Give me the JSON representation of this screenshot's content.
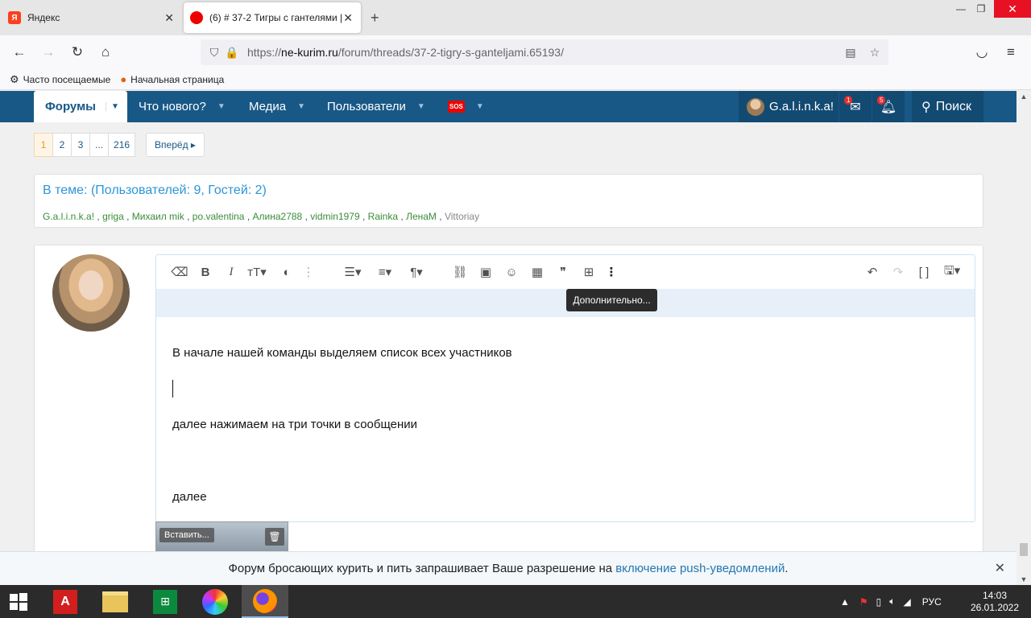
{
  "browser": {
    "tabs": [
      {
        "title": "Яндекс"
      },
      {
        "title": "(6) # 37-2 Тигры с гантелями |"
      }
    ],
    "url_prefix": "https://",
    "url_host": "ne-kurim.ru",
    "url_path": "/forum/threads/37-2-tigry-s-ganteljami.65193/",
    "bookmarks": [
      "Часто посещаемые",
      "Начальная страница"
    ]
  },
  "forum_nav": {
    "items": [
      "Форумы",
      "Что нового?",
      "Медиа",
      "Пользователи"
    ],
    "sos_label": "SOS",
    "username": "G.a.l.i.n.k.a!",
    "messages_badge": "1",
    "alerts_badge": "5",
    "search_label": "Поиск"
  },
  "pager": {
    "pages": [
      "1",
      "2",
      "3",
      "...",
      "216"
    ],
    "next_label": "Вперёд ▸"
  },
  "in_thread": {
    "title": "В теме: (Пользователей: 9, Гостей: 2)",
    "users": [
      "G.a.l.i.n.k.a!",
      "griga",
      "Михаил mik",
      "po.valentina",
      "Алина2788",
      "vidmin1979",
      "Rainka",
      "ЛенаМ"
    ],
    "last_user": "Vittoriay",
    "sep": ","
  },
  "editor": {
    "tooltip": "Дополнительно...",
    "lines": [
      "В начале нашей команды выделяем список всех участников",
      "далее нажимаем на три точки в сообщении",
      "далее"
    ]
  },
  "attachment": {
    "insert_label": "Вставить..."
  },
  "push": {
    "text": "Форум бросающих курить и пить запрашивает Ваше разрешение на",
    "link": "включение push-уведомлений",
    "dot": "."
  },
  "taskbar": {
    "lang": "РУС",
    "time": "14:03",
    "date": "26.01.2022"
  },
  "colors": {
    "forum_header": "#185886",
    "accent": "#2d96d6",
    "user_link": "#3a8c3a"
  }
}
